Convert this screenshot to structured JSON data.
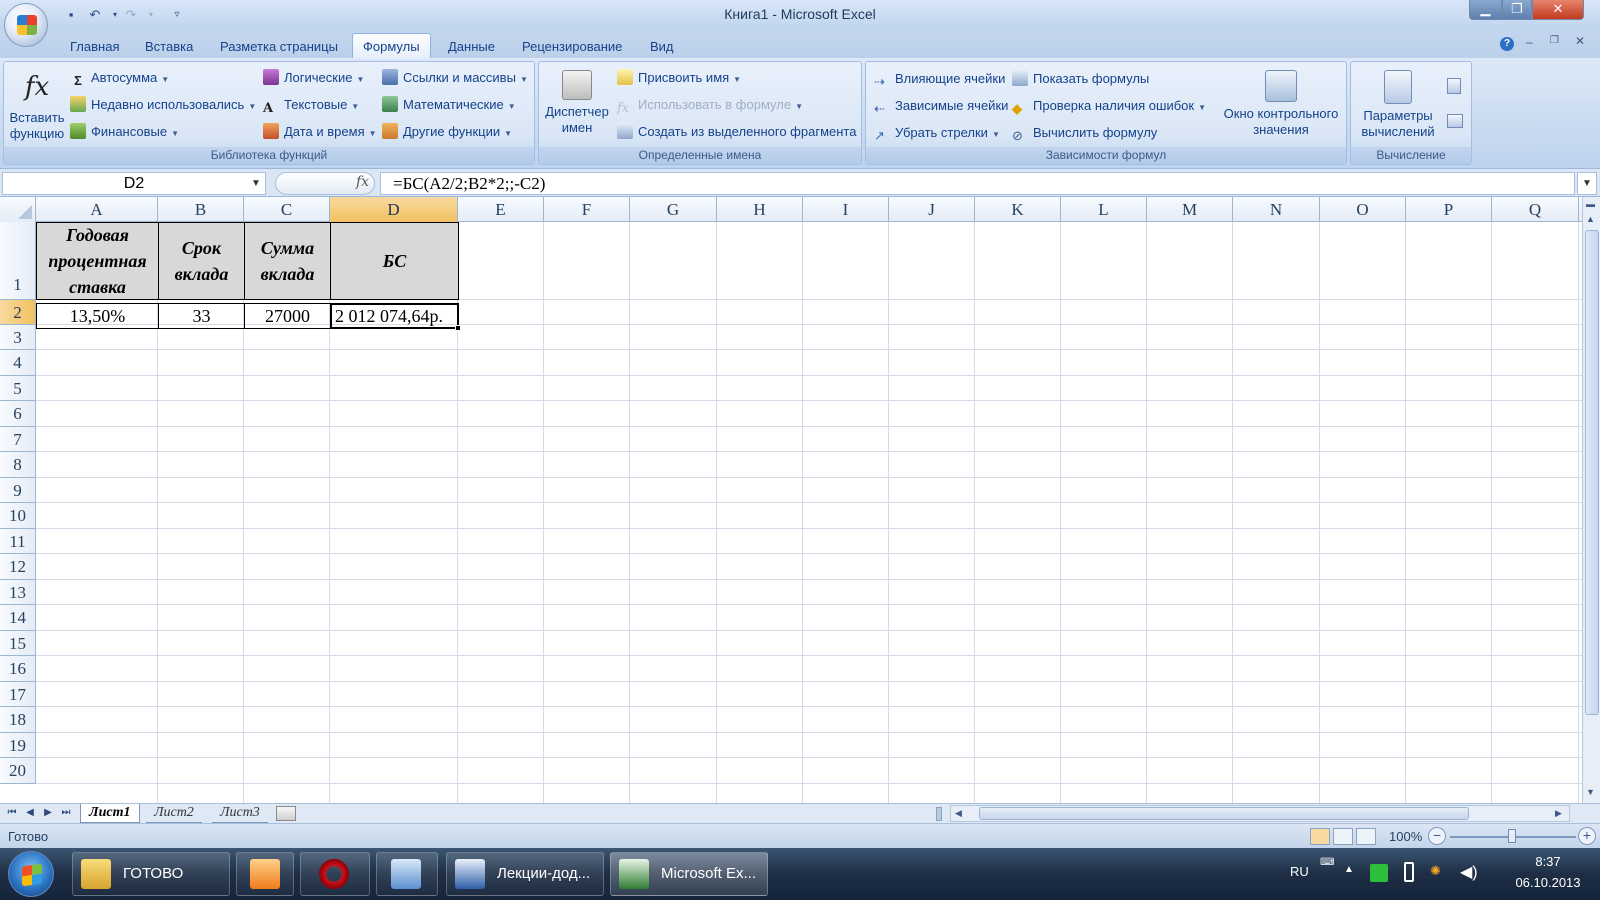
{
  "window": {
    "title": "Книга1 - Microsoft Excel",
    "buttons": {
      "minimize": "▁",
      "restore": "❐",
      "close": "✕"
    }
  },
  "tabs": [
    "Главная",
    "Вставка",
    "Разметка страницы",
    "Формулы",
    "Данные",
    "Рецензирование",
    "Вид"
  ],
  "ribbon": {
    "library": {
      "insert_function": "Вставить функцию",
      "autosum": "Автосумма",
      "recent": "Недавно использовались",
      "financial": "Финансовые",
      "logical": "Логические",
      "text": "Текстовые",
      "datetime": "Дата и время",
      "lookup": "Ссылки и массивы",
      "math": "Математические",
      "other": "Другие функции",
      "label": "Библиотека функций"
    },
    "names": {
      "manager": "Диспетчер имен",
      "define": "Присвоить имя",
      "use_in_formula": "Использовать в формуле",
      "create_from_selection": "Создать из выделенного фрагмента",
      "label": "Определенные имена"
    },
    "audit": {
      "precedents": "Влияющие ячейки",
      "dependents": "Зависимые ячейки",
      "remove_arrows": "Убрать стрелки",
      "show_formulas": "Показать формулы",
      "error_check": "Проверка наличия ошибок",
      "evaluate": "Вычислить формулу",
      "watch_window": "Окно контрольного значения",
      "label": "Зависимости формул"
    },
    "calc": {
      "options": "Параметры вычислений",
      "label": "Вычисление"
    }
  },
  "formula_bar": {
    "name_box": "D2",
    "formula": "=БС(A2/2;B2*2;;-C2)"
  },
  "sheet": {
    "columns": [
      "A",
      "B",
      "C",
      "D",
      "E",
      "F",
      "G",
      "H",
      "I",
      "J",
      "K",
      "L",
      "M",
      "N",
      "O",
      "P",
      "Q"
    ],
    "rows": [
      "1",
      "2",
      "3",
      "4",
      "5",
      "6",
      "7",
      "8",
      "9",
      "10",
      "11",
      "12",
      "13",
      "14",
      "15",
      "16",
      "17",
      "18",
      "19",
      "20"
    ],
    "header_row": [
      "Годовая процентная ставка",
      "Срок вклада",
      "Сумма вклада",
      "БС"
    ],
    "data_row": [
      "13,50%",
      "33",
      "27000",
      "2 012 074,64р."
    ],
    "selected_cell": "D2"
  },
  "sheet_tabs": [
    "Лист1",
    "Лист2",
    "Лист3"
  ],
  "status": {
    "text": "Готово",
    "zoom": "100%"
  },
  "taskbar": {
    "items": [
      "ГОТОВО",
      "Лекции-дод...",
      "Microsoft Ex..."
    ],
    "lang": "RU",
    "time": "8:37",
    "date": "06.10.2013"
  }
}
